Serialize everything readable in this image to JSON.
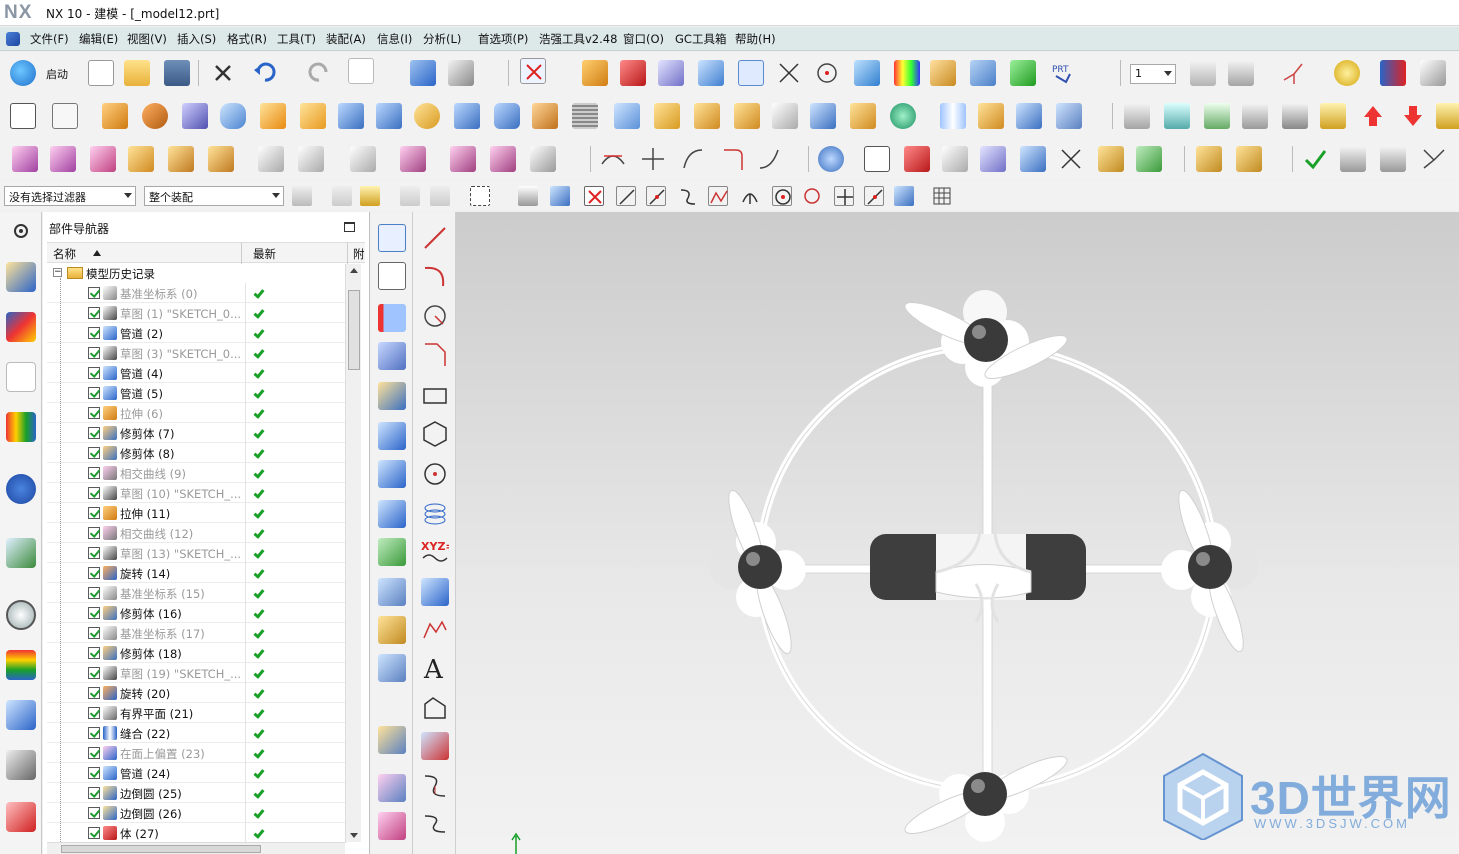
{
  "titlebar": {
    "logo": "NX",
    "title": "NX 10 - 建模 - [_model12.prt]"
  },
  "menubar": {
    "items": [
      {
        "label": "文件(F)"
      },
      {
        "label": "编辑(E)"
      },
      {
        "label": "视图(V)"
      },
      {
        "label": "插入(S)"
      },
      {
        "label": "格式(R)"
      },
      {
        "label": "工具(T)"
      },
      {
        "label": "装配(A)"
      },
      {
        "label": "信息(I)"
      },
      {
        "label": "分析(L)"
      },
      {
        "label": "首选项(P)"
      },
      {
        "label": "浩强工具v2.48"
      },
      {
        "label": "窗口(O)"
      },
      {
        "label": "GC工具箱"
      },
      {
        "label": "帮助(H)"
      }
    ]
  },
  "toolbar": {
    "start_label": "启动",
    "layer_value": "1"
  },
  "selection_bar": {
    "filter_value": "没有选择过滤器",
    "scope_value": "整个装配"
  },
  "navigator": {
    "title": "部件导航器",
    "col_name": "名称",
    "col_latest": "最新",
    "col_extra": "附",
    "root_label": "模型历史记录",
    "rows": [
      {
        "name": "基准坐标系 (0)",
        "icon": "datum-csys-icon",
        "dim": true
      },
      {
        "name": "草图 (1) \"SKETCH_0...",
        "icon": "sketch-icon",
        "dim": true
      },
      {
        "name": "管道 (2)",
        "icon": "tube-icon",
        "dim": false
      },
      {
        "name": "草图 (3) \"SKETCH_0...",
        "icon": "sketch-icon",
        "dim": true
      },
      {
        "name": "管道 (4)",
        "icon": "tube-icon",
        "dim": false
      },
      {
        "name": "管道 (5)",
        "icon": "tube-icon",
        "dim": false
      },
      {
        "name": "拉伸 (6)",
        "icon": "extrude-icon",
        "dim": true
      },
      {
        "name": "修剪体 (7)",
        "icon": "trim-body-icon",
        "dim": false
      },
      {
        "name": "修剪体 (8)",
        "icon": "trim-body-icon",
        "dim": false
      },
      {
        "name": "相交曲线 (9)",
        "icon": "intersection-curve-icon",
        "dim": true
      },
      {
        "name": "草图 (10) \"SKETCH_...",
        "icon": "sketch-icon",
        "dim": true
      },
      {
        "name": "拉伸 (11)",
        "icon": "extrude-icon",
        "dim": false
      },
      {
        "name": "相交曲线 (12)",
        "icon": "intersection-curve-icon",
        "dim": true
      },
      {
        "name": "草图 (13) \"SKETCH_...",
        "icon": "sketch-icon",
        "dim": true
      },
      {
        "name": "旋转 (14)",
        "icon": "revolve-icon",
        "dim": false
      },
      {
        "name": "基准坐标系 (15)",
        "icon": "datum-csys-icon",
        "dim": true
      },
      {
        "name": "修剪体 (16)",
        "icon": "trim-body-icon",
        "dim": false
      },
      {
        "name": "基准坐标系 (17)",
        "icon": "datum-csys-icon",
        "dim": true
      },
      {
        "name": "修剪体 (18)",
        "icon": "trim-body-icon",
        "dim": false
      },
      {
        "name": "草图 (19) \"SKETCH_...",
        "icon": "sketch-icon",
        "dim": true
      },
      {
        "name": "旋转 (20)",
        "icon": "revolve-icon",
        "dim": false
      },
      {
        "name": "有界平面 (21)",
        "icon": "bounded-plane-icon",
        "dim": false
      },
      {
        "name": "缝合 (22)",
        "icon": "sew-icon",
        "dim": false
      },
      {
        "name": "在面上偏置 (23)",
        "icon": "offset-curve-icon",
        "dim": true
      },
      {
        "name": "管道 (24)",
        "icon": "tube-icon",
        "dim": false
      },
      {
        "name": "边倒圆 (25)",
        "icon": "edge-blend-icon",
        "dim": false
      },
      {
        "name": "边倒圆 (26)",
        "icon": "edge-blend-icon",
        "dim": false
      },
      {
        "name": "体 (27)",
        "icon": "body-icon",
        "dim": false
      }
    ]
  },
  "watermark": {
    "text": "3D世界网",
    "url": "WWW.3DSJW.COM"
  },
  "colors": {
    "menubar_bg": "#dde8e8",
    "accent_blue": "#2a64c8",
    "check_green": "#18a028",
    "model_white": "#ffffff",
    "hub_dark": "#3a3a3a"
  }
}
